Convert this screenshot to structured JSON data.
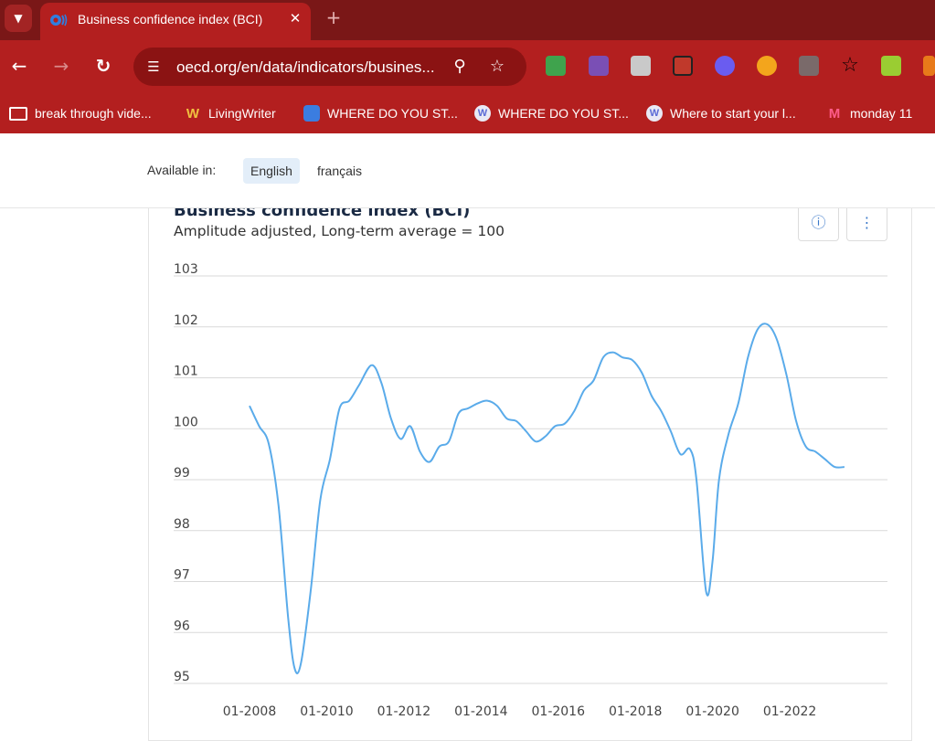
{
  "browser": {
    "tab": {
      "title": "Business confidence index (BCI)",
      "close": "✕"
    },
    "new_tab": "+",
    "nav": {
      "back": "←",
      "forward": "→",
      "reload": "↻"
    },
    "url": "oecd.org/en/data/indicators/busines...",
    "bookmarks": [
      {
        "label": "break through vide...",
        "icon": "folder-icon"
      },
      {
        "label": "LivingWriter",
        "icon": "livingwriter-icon"
      },
      {
        "label": "WHERE DO YOU ST...",
        "icon": "app-icon"
      },
      {
        "label": "WHERE DO YOU ST...",
        "icon": "w-circle-icon"
      },
      {
        "label": "Where to start your l...",
        "icon": "w-circle-icon"
      },
      {
        "label": "monday 11",
        "icon": "monday-icon"
      }
    ],
    "colors": {
      "frame": "#b31f1f",
      "tabstrip": "#7a1717",
      "omnibox": "#8b1313"
    }
  },
  "page": {
    "available_in_label": "Available in:",
    "languages": [
      {
        "label": "English",
        "selected": true
      },
      {
        "label": "français",
        "selected": false
      }
    ]
  },
  "card": {
    "info_icon": "ⓘ",
    "more_icon": "⋮"
  },
  "chart_data": {
    "type": "line",
    "title": "Business confidence index (BCI)",
    "subtitle": "Amplitude adjusted, Long-term average = 100",
    "xlabel": "",
    "ylabel": "",
    "ylim": [
      95,
      103
    ],
    "yticks": [
      "103",
      "102",
      "101",
      "100",
      "99",
      "98",
      "97",
      "96",
      "95"
    ],
    "xticks": [
      "01-2008",
      "01-2010",
      "01-2012",
      "01-2014",
      "01-2016",
      "01-2018",
      "01-2020",
      "01-2022"
    ],
    "xlim": [
      "2008-01",
      "2023-12"
    ],
    "grid": true,
    "line_color": "#5aabea",
    "series": [
      {
        "points": [
          [
            "2008-01",
            100.45
          ],
          [
            "2008-04",
            100.05
          ],
          [
            "2008-07",
            99.7
          ],
          [
            "2008-10",
            98.5
          ],
          [
            "2009-01",
            96.3
          ],
          [
            "2009-03",
            95.3
          ],
          [
            "2009-05",
            95.4
          ],
          [
            "2009-08",
            96.8
          ],
          [
            "2009-11",
            98.6
          ],
          [
            "2010-02",
            99.4
          ],
          [
            "2010-05",
            100.4
          ],
          [
            "2010-08",
            100.55
          ],
          [
            "2010-11",
            100.85
          ],
          [
            "2011-03",
            101.25
          ],
          [
            "2011-06",
            100.9
          ],
          [
            "2011-09",
            100.2
          ],
          [
            "2011-12",
            99.8
          ],
          [
            "2012-03",
            100.05
          ],
          [
            "2012-06",
            99.55
          ],
          [
            "2012-09",
            99.35
          ],
          [
            "2012-12",
            99.65
          ],
          [
            "2013-03",
            99.75
          ],
          [
            "2013-06",
            100.3
          ],
          [
            "2013-09",
            100.4
          ],
          [
            "2013-12",
            100.5
          ],
          [
            "2014-03",
            100.55
          ],
          [
            "2014-06",
            100.45
          ],
          [
            "2014-09",
            100.2
          ],
          [
            "2014-12",
            100.15
          ],
          [
            "2015-03",
            99.95
          ],
          [
            "2015-06",
            99.75
          ],
          [
            "2015-09",
            99.85
          ],
          [
            "2015-12",
            100.05
          ],
          [
            "2016-03",
            100.1
          ],
          [
            "2016-06",
            100.35
          ],
          [
            "2016-09",
            100.75
          ],
          [
            "2016-12",
            100.95
          ],
          [
            "2017-03",
            101.4
          ],
          [
            "2017-06",
            101.5
          ],
          [
            "2017-09",
            101.4
          ],
          [
            "2017-12",
            101.35
          ],
          [
            "2018-03",
            101.1
          ],
          [
            "2018-06",
            100.65
          ],
          [
            "2018-09",
            100.35
          ],
          [
            "2018-12",
            99.95
          ],
          [
            "2019-03",
            99.5
          ],
          [
            "2019-06",
            99.6
          ],
          [
            "2019-08",
            99.0
          ],
          [
            "2019-11",
            96.8
          ],
          [
            "2020-01",
            97.4
          ],
          [
            "2020-03",
            99.0
          ],
          [
            "2020-06",
            99.9
          ],
          [
            "2020-09",
            100.5
          ],
          [
            "2020-12",
            101.4
          ],
          [
            "2021-03",
            101.95
          ],
          [
            "2021-06",
            102.05
          ],
          [
            "2021-09",
            101.75
          ],
          [
            "2021-12",
            101.05
          ],
          [
            "2022-03",
            100.15
          ],
          [
            "2022-06",
            99.65
          ],
          [
            "2022-09",
            99.55
          ],
          [
            "2022-12",
            99.4
          ],
          [
            "2023-03",
            99.25
          ],
          [
            "2023-06",
            99.25
          ]
        ]
      }
    ]
  }
}
